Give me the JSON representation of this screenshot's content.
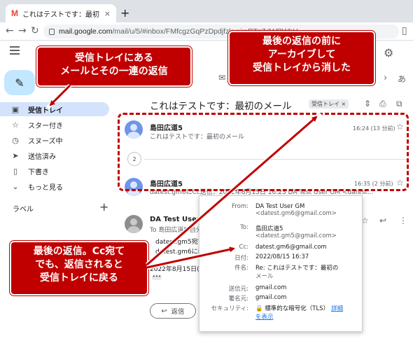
{
  "browser": {
    "tab_title": "これはテストです：最初のメール - da",
    "tab_close": "×",
    "new_tab": "+",
    "url_domain": "mail.google.com",
    "url_path": "/mail/u/5/#inbox/FMfcgzGqPzDpdjfzkvcjrsRTzZdWRWbV",
    "gmail_letter": "M"
  },
  "sidebar": {
    "items": [
      {
        "label": "受信トレイ",
        "icon": "inbox-icon",
        "glyph": "▣"
      },
      {
        "label": "スター付き",
        "icon": "star-icon",
        "glyph": "☆"
      },
      {
        "label": "スヌーズ中",
        "icon": "clock-icon",
        "glyph": "◷"
      },
      {
        "label": "送信済み",
        "icon": "send-icon",
        "glyph": "➤"
      },
      {
        "label": "下書き",
        "icon": "draft-icon",
        "glyph": "▯"
      },
      {
        "label": "もっと見る",
        "icon": "chevron-down-icon",
        "glyph": "⌄"
      }
    ],
    "labels_title": "ラベル",
    "labels_add": "+"
  },
  "toolbar": {
    "partial_label": "あ"
  },
  "thread": {
    "subject": "これはテストです：最初のメール",
    "label_chip": "受信トレイ ×",
    "collapsed_count": "2",
    "messages": [
      {
        "sender": "島田広道5",
        "snippet": "これはテストです：最初のメール",
        "time": "16:24 (13 分前)"
      },
      {
        "sender": "島田広道5",
        "snippet": "datest.gm6にCc送信：2022年8月15日 16:23 DA Test User GM <datest...",
        "time": "16:35 (2 分前)"
      },
      {
        "sender": "DA Test User GM",
        "to_line": "To 島田広道5 自分 ▾",
        "body1": "datest.gm5宛てに",
        "body2": "datest.gm6にはCc",
        "date_line": "2022年8月15日(月)"
      }
    ],
    "reply_label": "返信",
    "ellipsis": "•••"
  },
  "details_popup": {
    "rows": [
      {
        "label": "From:",
        "value": "DA Test User GM",
        "sub": "<datest.gm6@gmail.com>"
      },
      {
        "label": "To:",
        "value": "島田広道5",
        "sub": "<datest.gm5@gmail.com>"
      },
      {
        "label": "Cc:",
        "value": "datest.gm6@gmail.com",
        "sub": ""
      },
      {
        "label": "日付:",
        "value": "2022/08/15 16:37",
        "sub": ""
      },
      {
        "label": "件名:",
        "value": "Re: これはテストです：最初の",
        "sub": "メール"
      },
      {
        "label": "送信元:",
        "value": "gmail.com",
        "sub": ""
      },
      {
        "label": "署名元:",
        "value": "gmail.com",
        "sub": ""
      },
      {
        "label": "セキュリティ:",
        "value": "🔒 標準的な暗号化（TLS）",
        "link": "詳細",
        "sub": "を表示"
      }
    ]
  },
  "annotations": {
    "callout_top_left": [
      "受信トレイにある",
      "メールとその一連の返信"
    ],
    "callout_top_right": [
      "最後の返信の前に",
      "アーカイブして",
      "受信トレイから消した"
    ],
    "callout_bottom_left": [
      "最後の返信。Cc宛て",
      "でも、返信されると",
      "受信トレイに戻る"
    ],
    "accent_color": "#c00000"
  }
}
